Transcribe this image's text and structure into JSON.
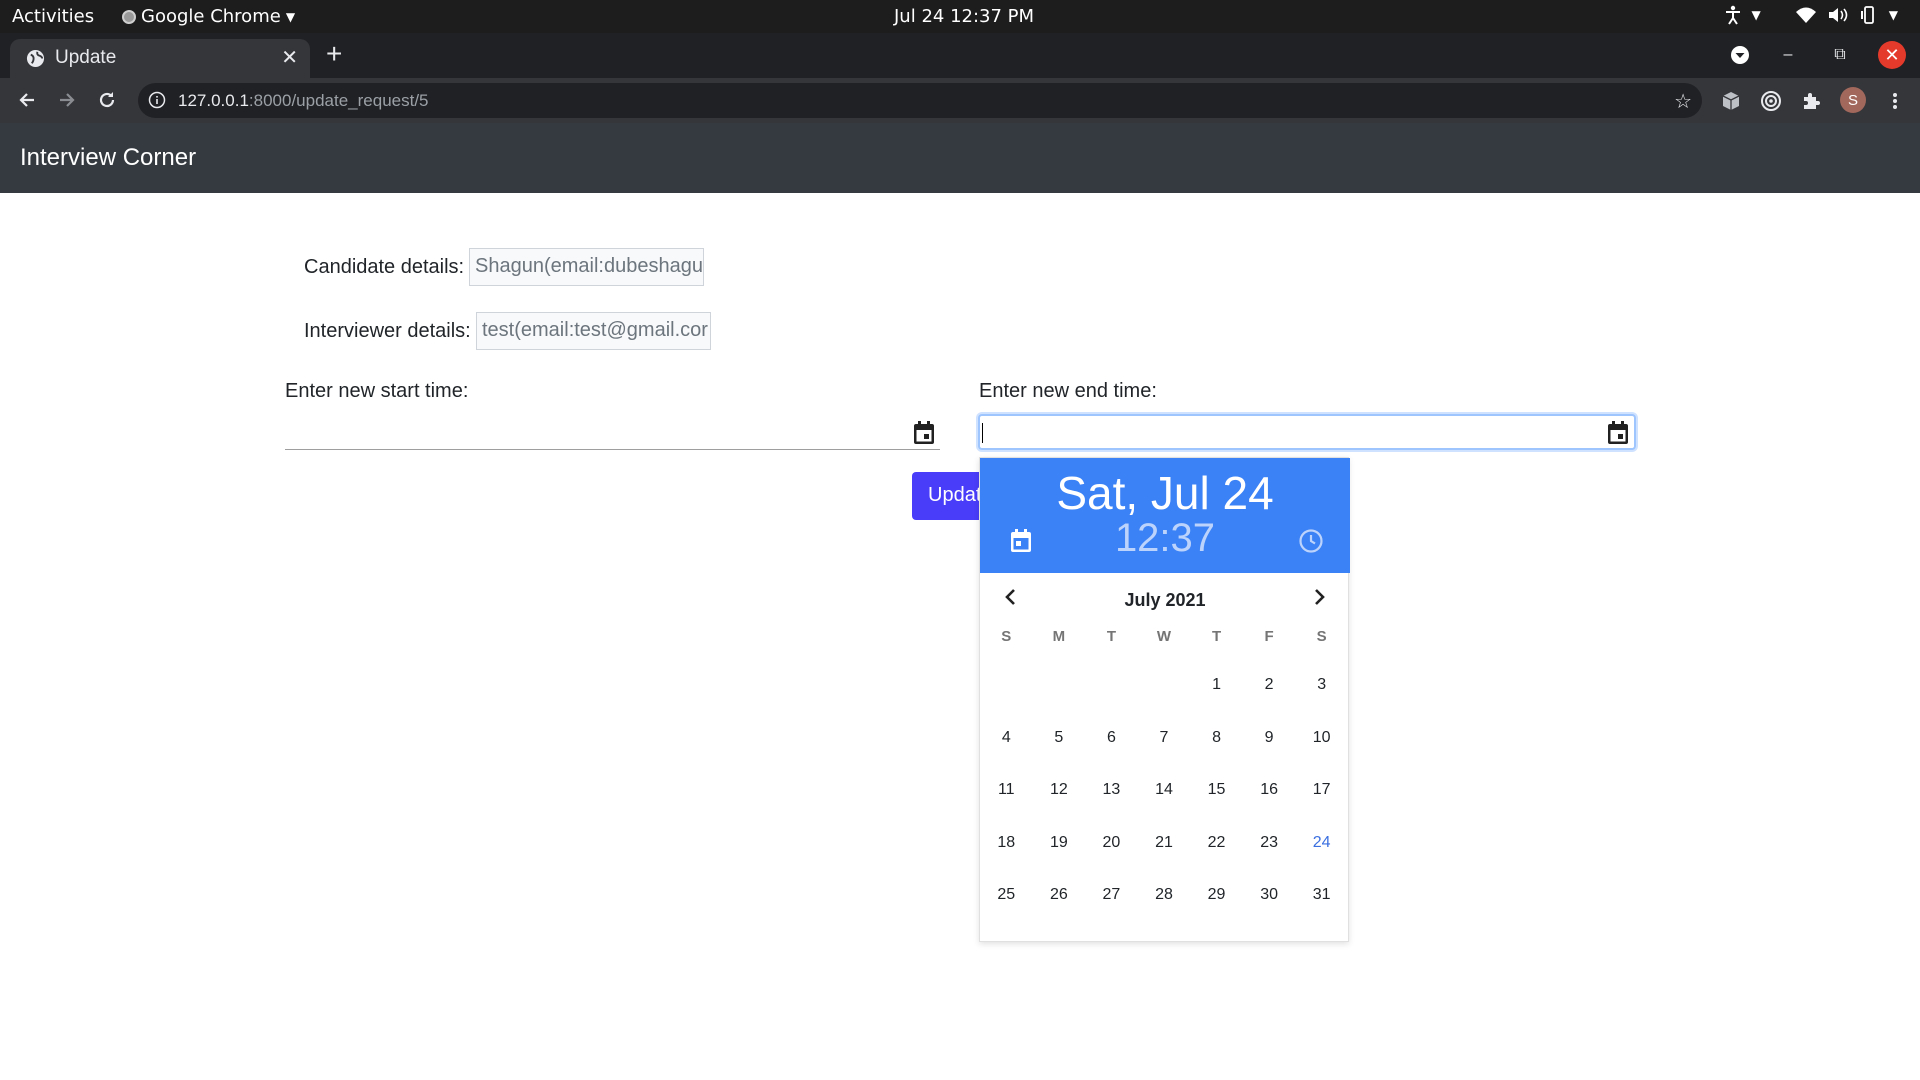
{
  "system_bar": {
    "activities": "Activities",
    "app_name": "Google Chrome",
    "clock": "Jul 24  12:37 PM"
  },
  "browser": {
    "tab_title": "Update",
    "url_host": "127.0.0.1",
    "url_rest": ":8000/update_request/5",
    "profile_initial": "S"
  },
  "app": {
    "brand": "Interview Corner"
  },
  "form": {
    "candidate_label": "Candidate details:",
    "candidate_value": "Shagun(email:dubeshagu",
    "interviewer_label": "Interviewer details:",
    "interviewer_value": "test(email:test@gmail.cor",
    "start_label": "Enter new start time:",
    "end_label": "Enter new end time:",
    "submit_label": "Update"
  },
  "picker": {
    "selected_date": "Sat, Jul 24",
    "selected_time": "12:37",
    "month_label": "July 2021",
    "weekdays": [
      "S",
      "M",
      "T",
      "W",
      "T",
      "F",
      "S"
    ],
    "weeks": [
      [
        "",
        "",
        "",
        "",
        "1",
        "2",
        "3"
      ],
      [
        "4",
        "5",
        "6",
        "7",
        "8",
        "9",
        "10"
      ],
      [
        "11",
        "12",
        "13",
        "14",
        "15",
        "16",
        "17"
      ],
      [
        "18",
        "19",
        "20",
        "21",
        "22",
        "23",
        "24"
      ],
      [
        "25",
        "26",
        "27",
        "28",
        "29",
        "30",
        "31"
      ]
    ],
    "accent_color": "#3b82f6"
  }
}
